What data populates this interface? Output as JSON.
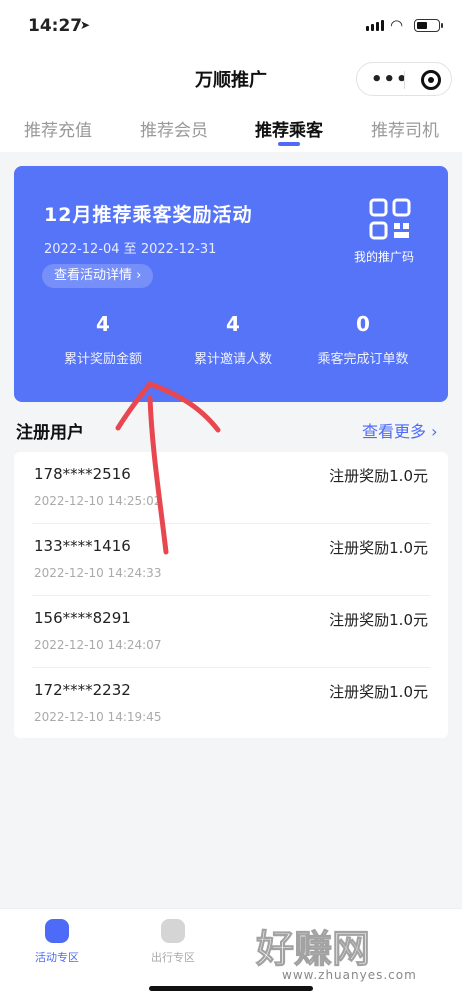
{
  "status_bar": {
    "time": "14:27"
  },
  "nav": {
    "title": "万顺推广",
    "more_label": "•••"
  },
  "tabs": [
    {
      "label": "推荐充值",
      "active": false
    },
    {
      "label": "推荐会员",
      "active": false
    },
    {
      "label": "推荐乘客",
      "active": true
    },
    {
      "label": "推荐司机",
      "active": false
    }
  ],
  "promo": {
    "title": "12月推荐乘客奖励活动",
    "dates": "2022-12-04 至 2022-12-31",
    "detail_link": "查看活动详情 ›",
    "qr_label": "我的推广码",
    "stats": [
      {
        "value": "4",
        "label": "累计奖励金额"
      },
      {
        "value": "4",
        "label": "累计邀请人数"
      },
      {
        "value": "0",
        "label": "乘客完成订单数"
      }
    ]
  },
  "registered": {
    "title": "注册用户",
    "see_more": "查看更多 ›",
    "users": [
      {
        "phone": "178****2516",
        "time": "2022-12-10 14:25:02",
        "reward": "注册奖励1.0元"
      },
      {
        "phone": "133****1416",
        "time": "2022-12-10 14:24:33",
        "reward": "注册奖励1.0元"
      },
      {
        "phone": "156****8291",
        "time": "2022-12-10 14:24:07",
        "reward": "注册奖励1.0元"
      },
      {
        "phone": "172****2232",
        "time": "2022-12-10 14:19:45",
        "reward": "注册奖励1.0元"
      }
    ]
  },
  "tabbar": [
    {
      "label": "活动专区",
      "active": true
    },
    {
      "label": "出行专区",
      "active": false
    }
  ],
  "watermark": {
    "main": "好赚网",
    "sub": "www.zhuanyes.com"
  },
  "colors": {
    "accent": "#4d6bf6",
    "card": "#5674f7",
    "annotation": "#e8474f"
  }
}
